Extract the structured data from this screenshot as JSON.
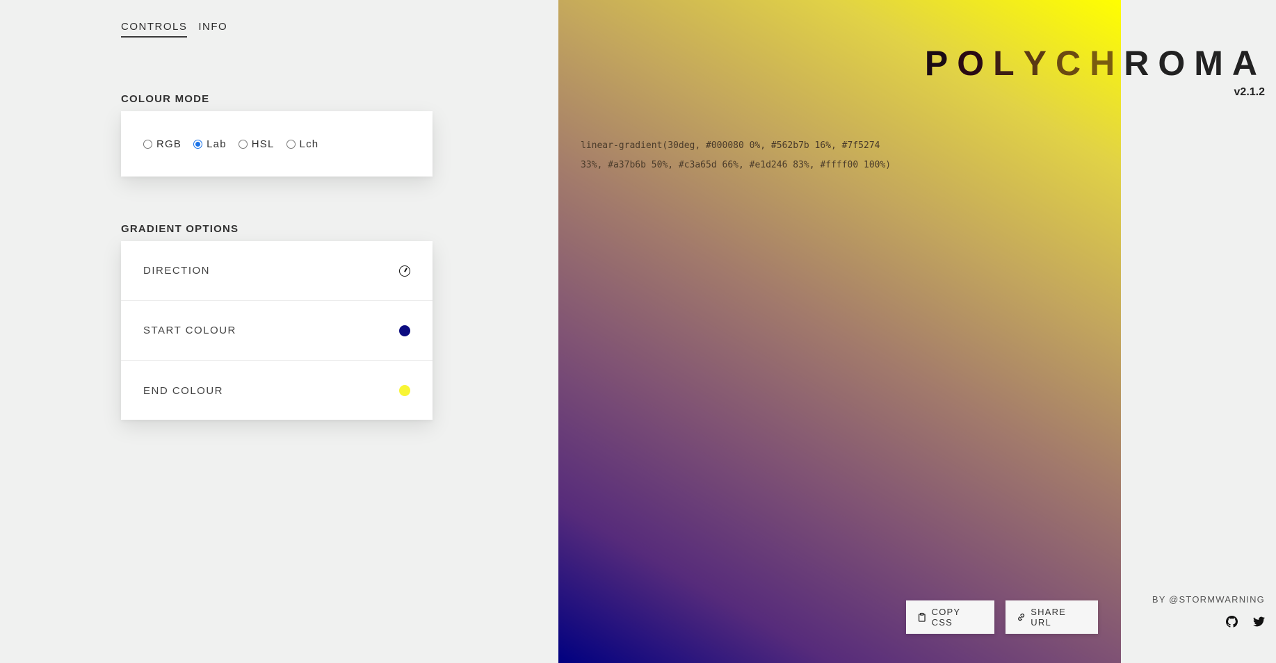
{
  "tabs": [
    {
      "label": "CONTROLS",
      "active": true
    },
    {
      "label": "INFO",
      "active": false
    }
  ],
  "colour_mode": {
    "title": "COLOUR MODE",
    "options": [
      "RGB",
      "Lab",
      "HSL",
      "Lch"
    ],
    "selected": "Lab"
  },
  "gradient_options": {
    "title": "GRADIENT OPTIONS",
    "rows": [
      {
        "label": "DIRECTION",
        "icon": "direction-dial-icon"
      },
      {
        "label": "START COLOUR",
        "swatch": "#0c0c80"
      },
      {
        "label": "END COLOUR",
        "swatch": "#f8f534"
      }
    ]
  },
  "preview": {
    "css_line1": "linear-gradient(30deg, #000080 0%, #562b7b 16%, #7f5274",
    "css_line2": "33%, #a37b6b 50%, #c3a65d 66%, #e1d246 83%, #ffff00 100%)",
    "copy_label": "COPY CSS",
    "share_label": "SHARE URL"
  },
  "branding": {
    "letters": [
      "P",
      "O",
      "L",
      "Y",
      "C",
      "H",
      "R",
      "O",
      "M",
      "A"
    ],
    "letter_colors": [
      "#1a0a14",
      "#2a0a14",
      "#3e1e14",
      "#5a3a14",
      "#6b4a12",
      "#7a5c10",
      "#222222",
      "#222222",
      "#222222",
      "#222222"
    ],
    "version": "v2.1.2",
    "byline": "BY @STORMWARNING"
  }
}
